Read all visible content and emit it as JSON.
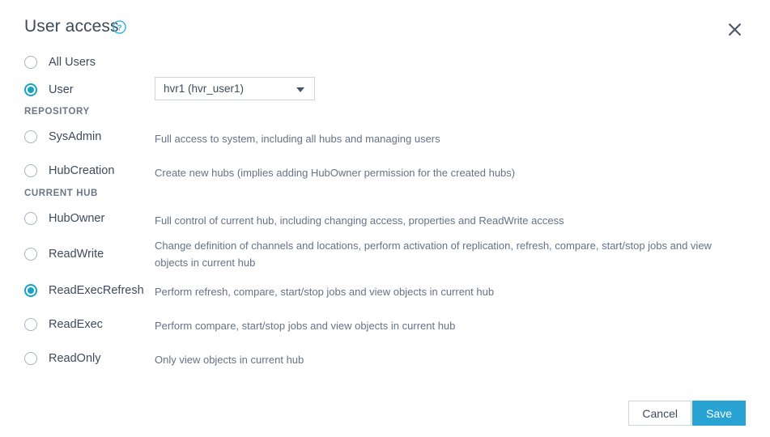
{
  "dialog": {
    "title": "User access",
    "help_icon": "help-circle-icon",
    "close_icon": "close-icon"
  },
  "scope": {
    "options": [
      {
        "label": "All Users",
        "checked": false,
        "name": "all-users"
      },
      {
        "label": "User",
        "checked": true,
        "name": "user"
      }
    ]
  },
  "user_select": {
    "value": "hvr1 (hvr_user1)",
    "placeholder": "Select user",
    "caret_icon": "chevron-down-icon"
  },
  "sections": [
    {
      "label": "REPOSITORY",
      "items": [
        {
          "label": "SysAdmin",
          "description": "Full access to system, including all hubs and managing users",
          "checked": false,
          "name": "sysadmin"
        },
        {
          "label": "HubCreation",
          "description": "Create new hubs (implies adding HubOwner permission for the created hubs)",
          "checked": false,
          "name": "hubcreation"
        }
      ]
    },
    {
      "label": "CURRENT HUB",
      "items": [
        {
          "label": "HubOwner",
          "description": "Full control of current hub, including changing access, properties and ReadWrite access",
          "checked": false,
          "name": "hubowner"
        },
        {
          "label": "ReadWrite",
          "description": "Change definition of channels and locations, perform activation of replication, refresh, compare, start/stop jobs and view objects in current hub",
          "checked": false,
          "name": "readwrite"
        },
        {
          "label": "ReadExecRefresh",
          "description": "Perform refresh, compare, start/stop jobs and view objects in current hub",
          "checked": true,
          "name": "readexecrefresh"
        },
        {
          "label": "ReadExec",
          "description": "Perform compare, start/stop jobs and view objects in current hub",
          "checked": false,
          "name": "readexec"
        },
        {
          "label": "ReadOnly",
          "description": "Only view objects in current hub",
          "checked": false,
          "name": "readonly"
        }
      ]
    }
  ],
  "footer": {
    "cancel_label": "Cancel",
    "save_label": "Save"
  },
  "colors": {
    "accent": "#17a2c6",
    "save_button": "#29a3d4",
    "text": "#3f4b5b",
    "muted_text": "#667285",
    "border": "#cfd4db"
  }
}
